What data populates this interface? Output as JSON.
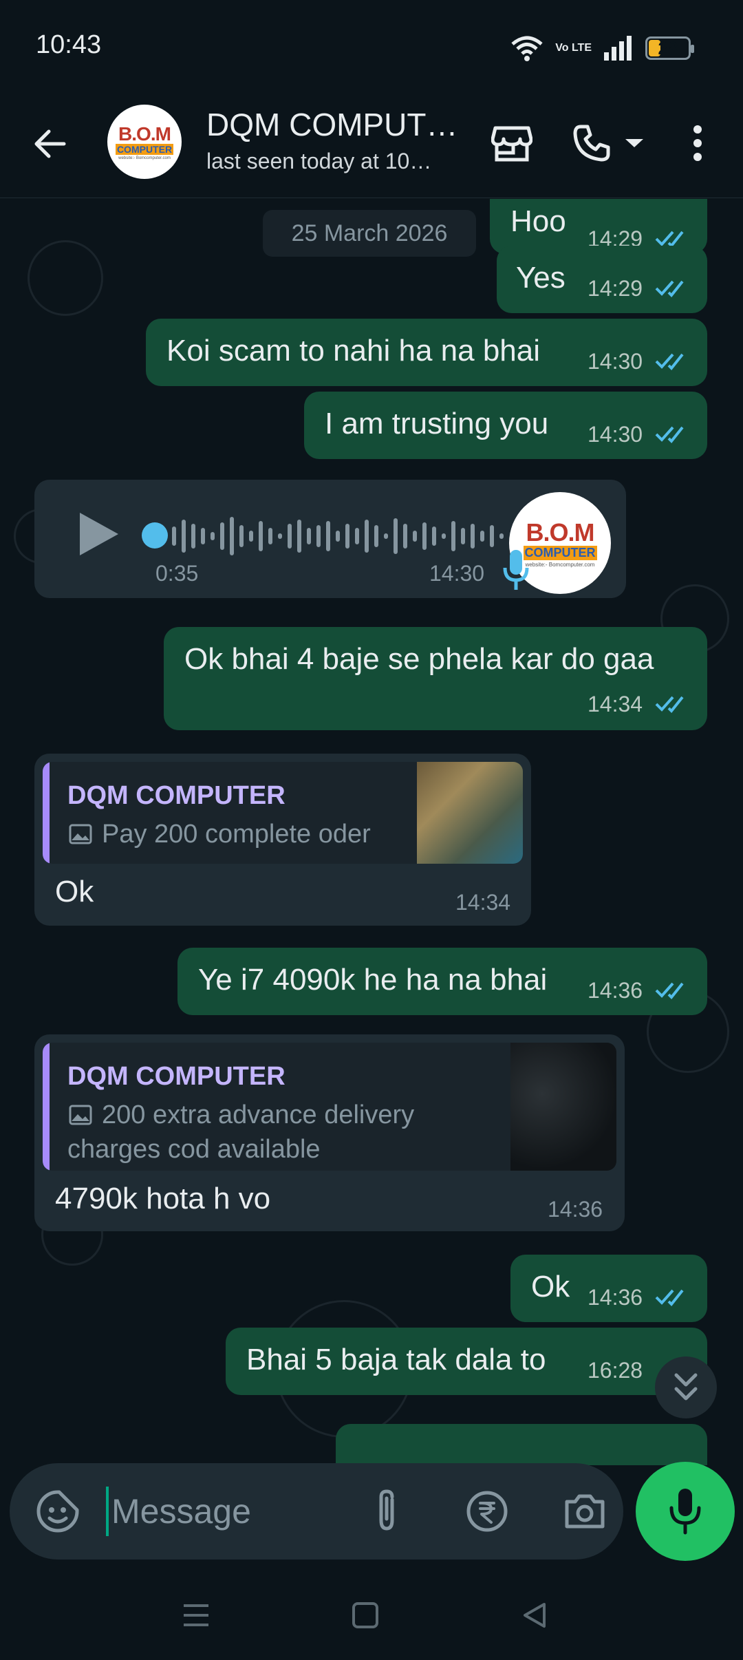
{
  "status_bar": {
    "time": "10:43",
    "network": "Vo LTE",
    "battery": "28"
  },
  "header": {
    "contact_name": "DQM COMPUT…",
    "last_seen": "last seen today at 10…",
    "avatar_logo": "B.O.M",
    "avatar_logo_sub": "COMPUTER",
    "avatar_logo_web": "website:- Bomcomputer.com"
  },
  "chat": {
    "date_chip": "25 March 2026",
    "messages": [
      {
        "dir": "out",
        "text": "Hoo",
        "time": "14:29",
        "status": "read"
      },
      {
        "dir": "out",
        "text": "Yes",
        "time": "14:29",
        "status": "read"
      },
      {
        "dir": "out",
        "text": "Koi scam to nahi ha na bhai",
        "time": "14:30",
        "status": "read"
      },
      {
        "dir": "out",
        "text": "I am trusting you",
        "time": "14:30",
        "status": "read"
      },
      {
        "dir": "in",
        "type": "voice",
        "duration": "0:35",
        "time": "14:30"
      },
      {
        "dir": "out",
        "text": "Ok bhai 4 baje se phela kar do gaa",
        "time": "14:34",
        "status": "read"
      },
      {
        "dir": "in",
        "text": "Ok",
        "time": "14:34",
        "reply": {
          "name": "DQM COMPUTER",
          "text": "Pay 200 complete oder"
        }
      },
      {
        "dir": "out",
        "text": "Ye i7 4090k he ha na bhai",
        "time": "14:36",
        "status": "read"
      },
      {
        "dir": "in",
        "text": "4790k hota h vo",
        "time": "14:36",
        "reply": {
          "name": "DQM COMPUTER",
          "text_line1": "200 extra advance delivery",
          "text_line2": "charges cod available"
        }
      },
      {
        "dir": "out",
        "text": "Ok",
        "time": "14:36",
        "status": "read"
      },
      {
        "dir": "out",
        "text": "Bhai 5 baja tak dala to",
        "time": "16:28",
        "status": "read"
      }
    ]
  },
  "input": {
    "placeholder": "Message"
  },
  "icons": {
    "back": "arrow-left-icon",
    "shop": "store-icon",
    "call": "phone-icon",
    "more": "more-vert-icon",
    "emoji": "sticker-icon",
    "attach": "paperclip-icon",
    "rupee": "rupee-icon",
    "camera": "camera-icon",
    "mic": "mic-icon"
  },
  "colors": {
    "accent": "#21c063",
    "outgoing": "#144d37",
    "incoming": "#1f2c34",
    "read_ticks": "#53bdeb",
    "reply_bar": "#a78bfa"
  }
}
